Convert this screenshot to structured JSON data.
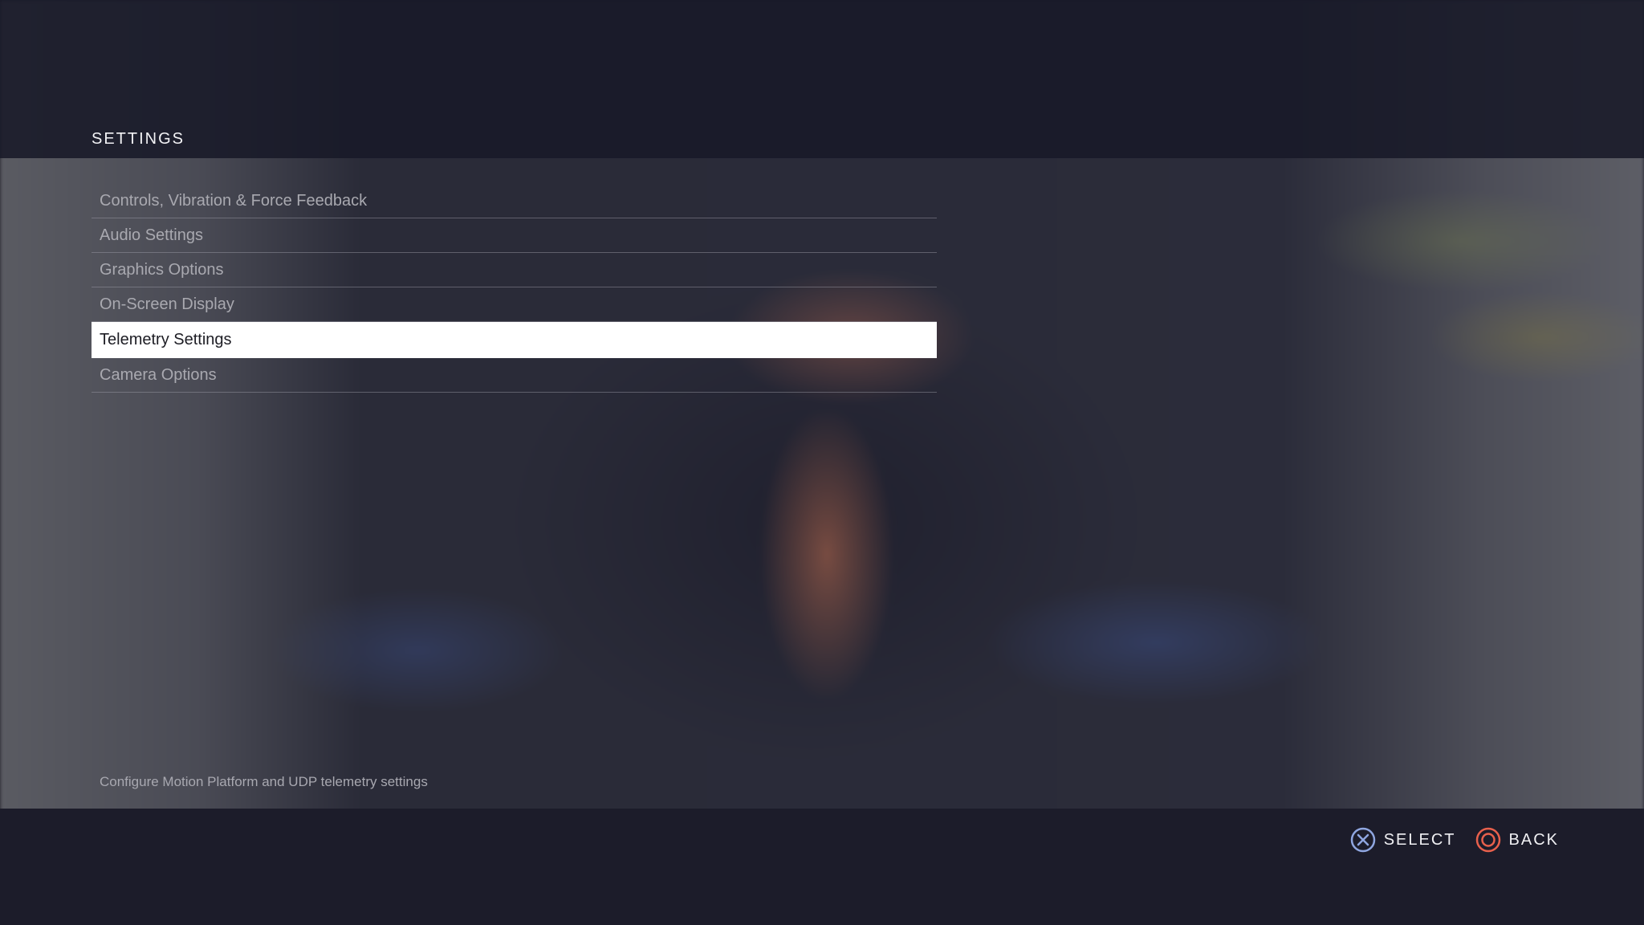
{
  "header": {
    "title": "SETTINGS"
  },
  "menu": {
    "items": [
      {
        "label": "Controls, Vibration & Force Feedback",
        "selected": false
      },
      {
        "label": "Audio Settings",
        "selected": false
      },
      {
        "label": "Graphics Options",
        "selected": false
      },
      {
        "label": "On-Screen Display",
        "selected": false
      },
      {
        "label": "Telemetry Settings",
        "selected": true
      },
      {
        "label": "Camera Options",
        "selected": false
      }
    ]
  },
  "description": "Configure Motion Platform and UDP telemetry settings",
  "controls": {
    "select": {
      "label": "SELECT",
      "icon": "cross-button-icon",
      "color": "#8fa6e0"
    },
    "back": {
      "label": "BACK",
      "icon": "circle-button-icon",
      "color": "#e8604c"
    }
  }
}
